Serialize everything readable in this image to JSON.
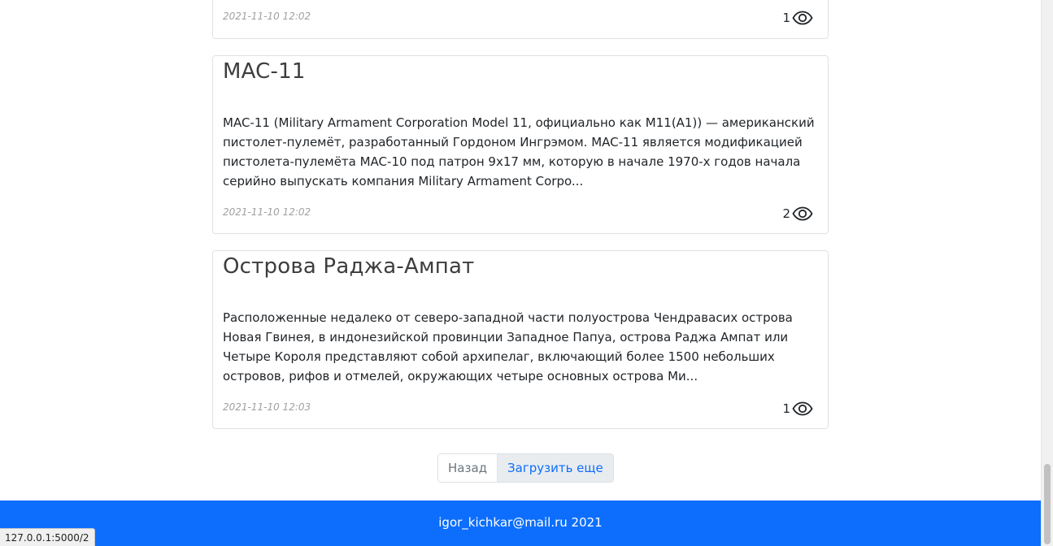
{
  "posts": [
    {
      "title": "",
      "text": "",
      "date": "2021-11-10 12:02",
      "views": "1"
    },
    {
      "title": "MAC-11",
      "text": "MAC-11 (Military Armament Corporation Model 11, официально как M11(A1)) — американский пистолет-пулемёт, разработанный Гордоном Ингрэмом. MAC-11 является модификацией пистолета-пулемёта MAC-10 под патрон 9x17 мм, которую в начале 1970-х годов начала серийно выпускать компания Military Armament Corpo...",
      "date": "2021-11-10 12:02",
      "views": "2"
    },
    {
      "title": "Острова Раджа-Ампат",
      "text": "Расположенные недалеко от северо-западной части полуострова Чендравасих острова Новая Гвинея, в индонезийской провинции Западное Папуа, острова Раджа Ампат или Четыре Короля представляют собой архипелаг, включающий более 1500 небольших островов, рифов и отмелей, окружающих четыре основных острова Ми...",
      "date": "2021-11-10 12:03",
      "views": "1"
    }
  ],
  "pagination": {
    "prev_label": "Назад",
    "next_label": "Загрузить еще"
  },
  "footer": {
    "text": "igor_kichkar@mail.ru 2021"
  },
  "status_bar": {
    "url": "127.0.0.1:5000/2"
  },
  "icons": {
    "views": "eye-icon"
  },
  "colors": {
    "footer_bg": "#0d6efd",
    "link": "#0d6efd"
  }
}
